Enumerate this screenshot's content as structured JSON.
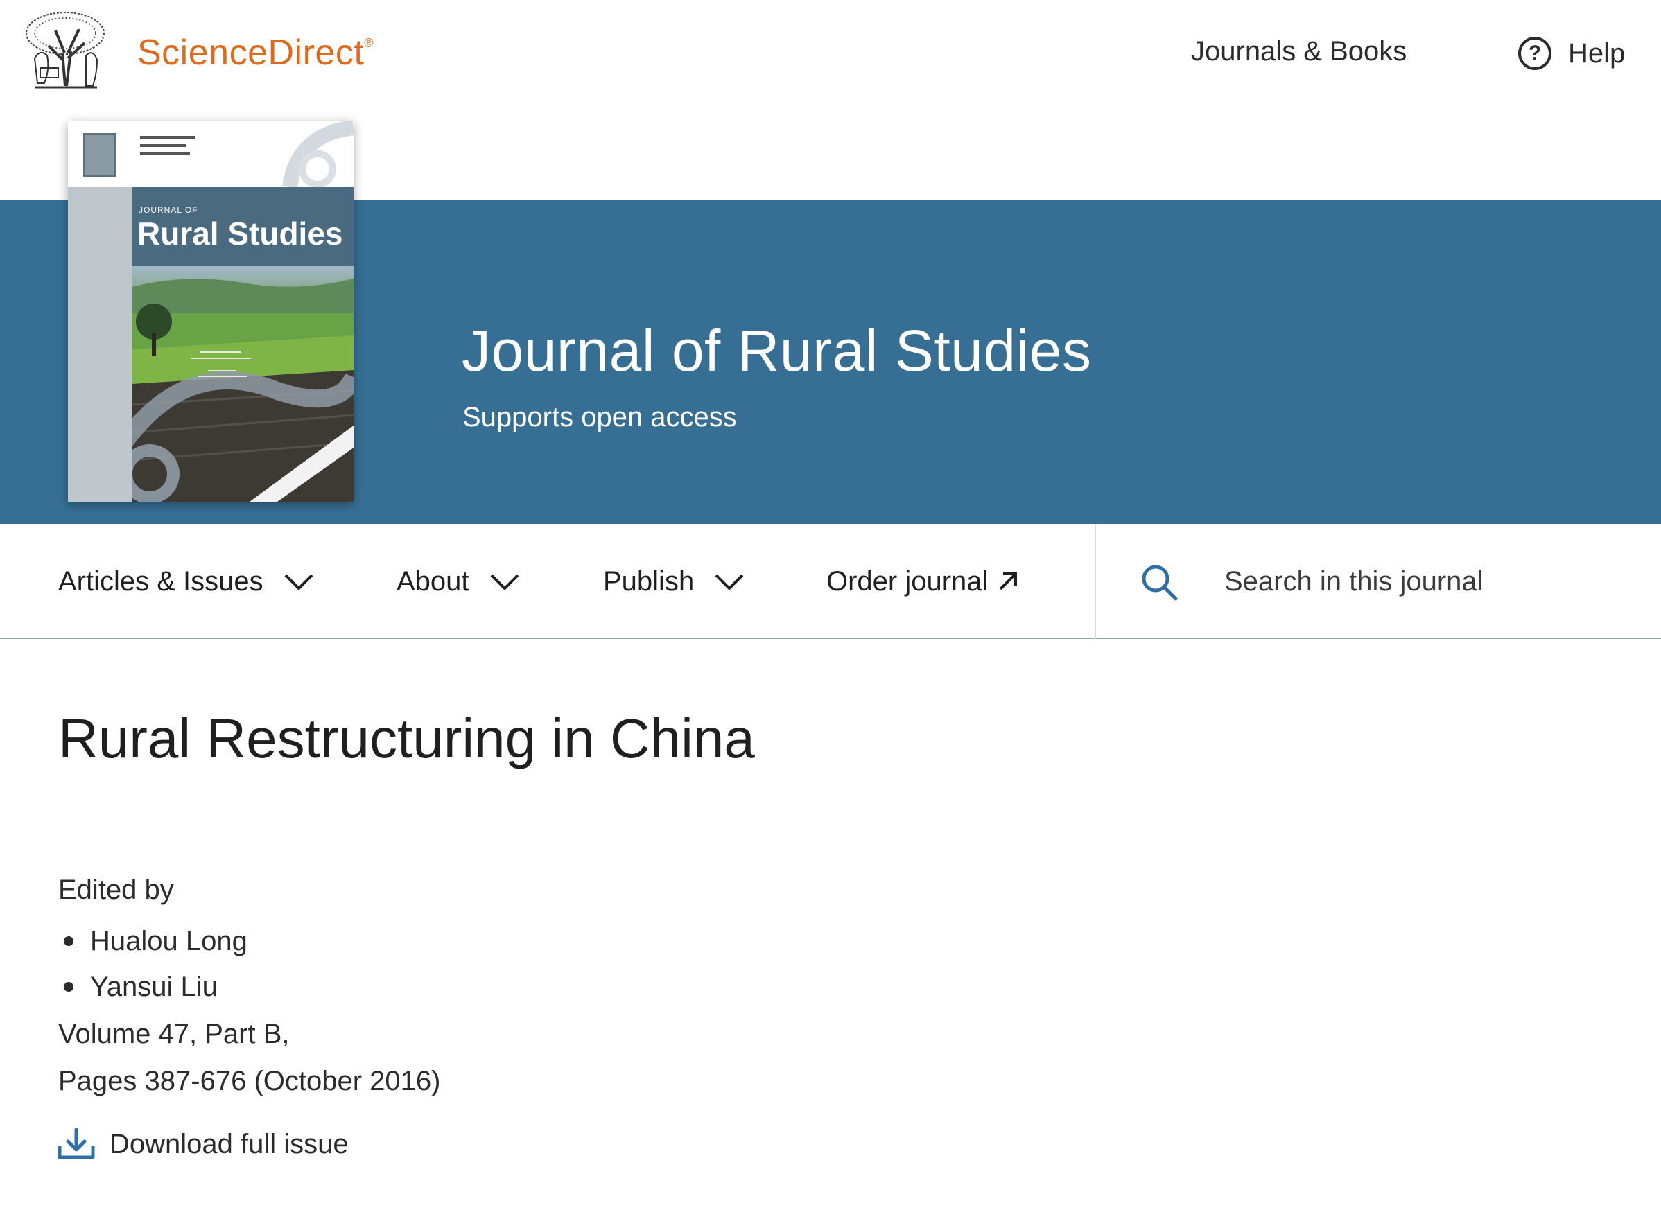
{
  "header": {
    "brand": "ScienceDirect",
    "brand_mark": "®",
    "journals_books": "Journals & Books",
    "help_label": "Help",
    "help_glyph": "?"
  },
  "banner": {
    "journal_title": "Journal of Rural Studies",
    "subtitle": "Supports open access",
    "background_color": "#376f94"
  },
  "cover": {
    "small_header": "JOURNAL OF",
    "title": "Rural Studies"
  },
  "subnav": {
    "articles_issues": "Articles & Issues",
    "about": "About",
    "publish": "Publish",
    "order_journal": "Order journal",
    "search_placeholder": "Search in this journal"
  },
  "issue": {
    "title": "Rural Restructuring in China",
    "edited_by": "Edited by",
    "editors": [
      "Hualou Long",
      "Yansui Liu"
    ],
    "volume": "Volume 47, Part B,",
    "pages": "Pages 387-676 (October 2016)",
    "download_label": "Download full issue"
  },
  "colors": {
    "brand_orange": "#e06a1b",
    "link_blue": "#2e6fa7"
  },
  "icons": {
    "help": "help-circle-icon",
    "chevron": "chevron-down-icon",
    "external": "external-link-icon",
    "search": "search-icon",
    "download": "download-icon"
  }
}
